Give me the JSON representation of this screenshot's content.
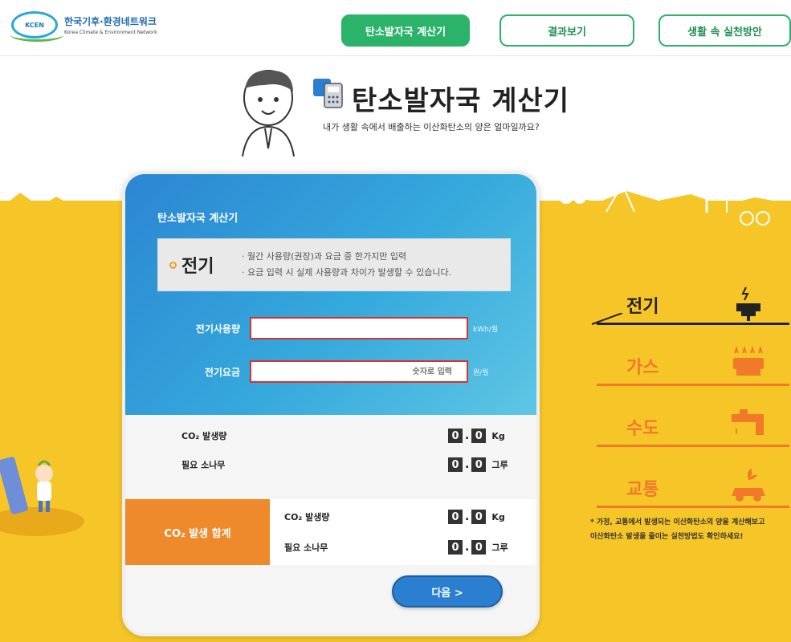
{
  "header": {
    "logo_ko": "한국기후·환경네트워크",
    "logo_en": "Korea Climate & Environment Network",
    "logo_badge": "KCEN",
    "nav": [
      "탄소발자국 계산기",
      "결과보기",
      "생활 속 실천방안"
    ]
  },
  "title": {
    "main": "탄소발자국 계산기",
    "subtitle": "내가 생활 속에서 배출하는 이산화탄소의 양은 얼마일까요?"
  },
  "calculator": {
    "card_title": "탄소발자국 계산기",
    "section_label": "전기",
    "info_lines": [
      "· 월간 사용량(권장)과 요금 중 한가지만 입력",
      "· 요금 입력 시 실제 사용량과 차이가 발생할 수 있습니다."
    ],
    "usage_label": "전기사용량",
    "usage_value": "",
    "usage_unit": "kWh/월",
    "fee_label": "전기요금",
    "fee_placeholder": "숫자로 입력",
    "fee_unit": "원/월",
    "co2_label": "CO₂ 발생량",
    "co2_digits": [
      "0",
      "0"
    ],
    "co2_unit": "Kg",
    "tree_label": "필요 소나무",
    "tree_digits": [
      "0",
      "0"
    ],
    "tree_unit": "그루",
    "total_label": "CO₂ 발생 합계",
    "total_co2_label": "CO₂ 발생량",
    "total_co2_digits": [
      "0",
      "0"
    ],
    "total_co2_unit": "Kg",
    "total_tree_label": "필요 소나무",
    "total_tree_digits": [
      "0",
      "0"
    ],
    "total_tree_unit": "그루",
    "next_label": "다음 >"
  },
  "categories": [
    {
      "name": "전기",
      "icon": "plug-icon"
    },
    {
      "name": "가스",
      "icon": "gas-stove-icon"
    },
    {
      "name": "수도",
      "icon": "faucet-icon"
    },
    {
      "name": "교통",
      "icon": "car-icon"
    }
  ],
  "note_lines": [
    "* 가정, 교통에서 발생되는 이산화탄소의 양을 계산해보고",
    "이산화탄소 발생을 줄이는 실천방법도 확인하세요!"
  ],
  "colors": {
    "accent_green": "#2bb36a",
    "background_yellow": "#f6c629",
    "card_blue": "#2b86d2",
    "total_orange": "#ef8a2c",
    "category_orange": "#f07a2a",
    "input_border_red": "#d8322f"
  }
}
